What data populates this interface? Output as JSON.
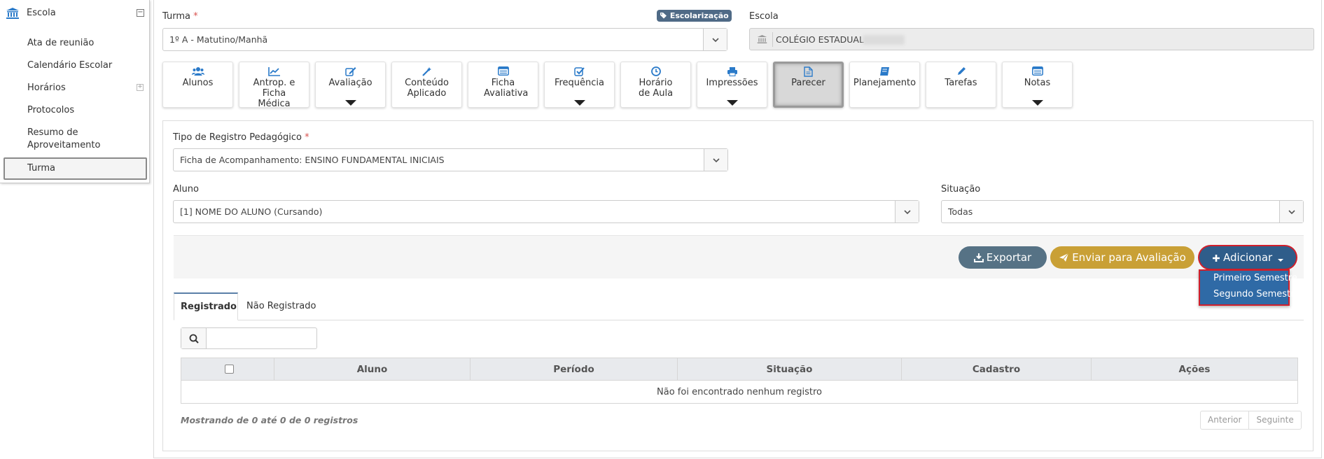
{
  "sidebar": {
    "header": "Escola",
    "items": [
      {
        "label": "Ata de reunião"
      },
      {
        "label": "Calendário Escolar"
      },
      {
        "label": "Horários"
      },
      {
        "label": "Protocolos"
      },
      {
        "label": "Resumo de Aproveitamento"
      },
      {
        "label": "Turma"
      }
    ],
    "selected": "Turma"
  },
  "form": {
    "turma_label": "Turma",
    "turma_value": "1º A - Matutino/Manhã",
    "badge": "Escolarização",
    "escola_label": "Escola",
    "escola_value": "COLÉGIO ESTADUAL",
    "tipo_label": "Tipo de Registro Pedagógico",
    "tipo_value": "Ficha de Acompanhamento: ENSINO FUNDAMENTAL INICIAIS",
    "aluno_label": "Aluno",
    "aluno_value": "[1] NOME DO ALUNO (Cursando)",
    "situacao_label": "Situação",
    "situacao_value": "Todas",
    "required_mark": "*"
  },
  "tiles": [
    {
      "label": "Alunos",
      "icon": "users-icon"
    },
    {
      "label": "Antrop. e Ficha Médica",
      "icon": "chart-line-icon"
    },
    {
      "label": "Avaliação",
      "icon": "edit-icon",
      "dropdown": true
    },
    {
      "label": "Conteúdo Aplicado",
      "icon": "magic-wand-icon"
    },
    {
      "label": "Ficha Avaliativa",
      "icon": "list-window-icon"
    },
    {
      "label": "Frequência",
      "icon": "check-square-icon",
      "dropdown": true
    },
    {
      "label": "Horário de Aula",
      "icon": "clock-icon"
    },
    {
      "label": "Impressões",
      "icon": "printer-icon",
      "dropdown": true
    },
    {
      "label": "Parecer",
      "icon": "document-icon",
      "active": true
    },
    {
      "label": "Planejamento",
      "icon": "book-icon"
    },
    {
      "label": "Tarefas",
      "icon": "pencil-icon"
    },
    {
      "label": "Notas",
      "icon": "list-window-icon",
      "dropdown": true
    }
  ],
  "actions": {
    "export": "Exportar",
    "send": "Enviar para Avaliação",
    "add": "Adicionar",
    "add_menu": [
      "Primeiro Semestre",
      "Segundo Semestre"
    ]
  },
  "tabs": {
    "registered": "Registrado",
    "not_registered": "Não Registrado"
  },
  "table": {
    "columns": [
      "Aluno",
      "Período",
      "Situação",
      "Cadastro",
      "Ações"
    ],
    "empty": "Não foi encontrado nenhum registro",
    "info": "Mostrando de 0 até 0 de 0 registros",
    "prev": "Anterior",
    "next": "Seguinte"
  },
  "colors": {
    "accent": "#5a7fa8",
    "export_btn": "#567285",
    "send_btn": "#c9a036",
    "add_btn": "#2f5d8a",
    "highlight": "#d11f2b",
    "icon_blue": "#2a7ac9"
  }
}
